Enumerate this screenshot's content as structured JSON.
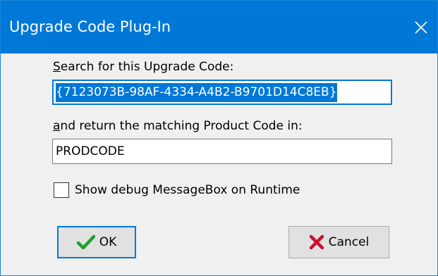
{
  "window": {
    "title": "Upgrade Code Plug-In",
    "close_icon": "close-icon"
  },
  "form": {
    "search_label_accel": "S",
    "search_label_rest": "earch for this Upgrade Code:",
    "upgrade_code_value": "{7123073B-98AF-4334-A4B2-B9701D14C8EB}",
    "return_label_accel": "a",
    "return_label_rest": "nd return the matching Product Code in:",
    "product_code_property": "PRODCODE",
    "debug_checkbox_label": "Show debug MessageBox on Runtime",
    "debug_checkbox_checked": false
  },
  "buttons": {
    "ok_label": "OK",
    "ok_icon": "checkmark-icon",
    "cancel_label": "Cancel",
    "cancel_icon": "x-mark-icon"
  },
  "colors": {
    "titlebar": "#0078d7",
    "selection": "#0078d7",
    "ok_check": "#1e9e2c",
    "cancel_x": "#c8102e"
  }
}
